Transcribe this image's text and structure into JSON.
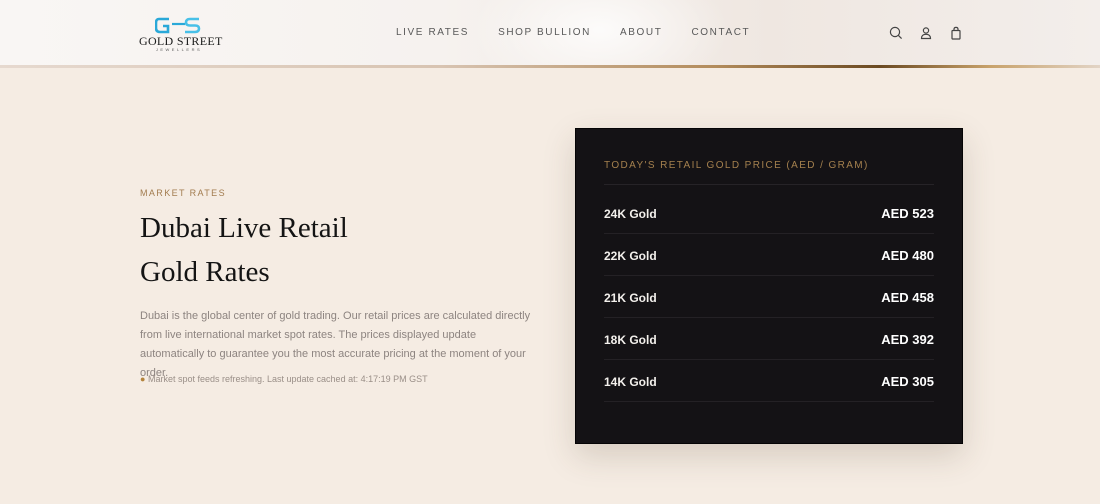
{
  "brand": {
    "name": "GOLD STREET",
    "sub": "JEWELLERS",
    "logo_colors": [
      "#2aa8d8",
      "#49c0e8"
    ]
  },
  "nav": {
    "items": [
      {
        "label": "LIVE RATES"
      },
      {
        "label": "SHOP BULLION"
      },
      {
        "label": "ABOUT"
      },
      {
        "label": "CONTACT"
      }
    ]
  },
  "header_icons": [
    "search-icon",
    "user-icon",
    "shopping-bag-icon"
  ],
  "hero": {
    "eyebrow": "MARKET RATES",
    "title_line1": "Dubai Live Retail",
    "title_line2": "Gold Rates",
    "description": "Dubai is the global center of gold trading. Our retail prices are calculated directly from live international market spot rates. The prices displayed update automatically to guarantee you the most accurate pricing at the moment of your order.",
    "status_dot": "●",
    "status": "Market spot feeds refreshing. Last update cached at: 4:17:19 PM GST"
  },
  "rates_card": {
    "title": "TODAY'S RETAIL GOLD PRICE (AED / GRAM)",
    "rows": [
      {
        "label": "24K Gold",
        "value": "AED 523"
      },
      {
        "label": "22K Gold",
        "value": "AED 480"
      },
      {
        "label": "21K Gold",
        "value": "AED 458"
      },
      {
        "label": "18K Gold",
        "value": "AED 392"
      },
      {
        "label": "14K Gold",
        "value": "AED 305"
      }
    ]
  },
  "colors": {
    "background": "#f5ece3",
    "accent_gold": "#a27c4f",
    "card_background": "#141215"
  }
}
